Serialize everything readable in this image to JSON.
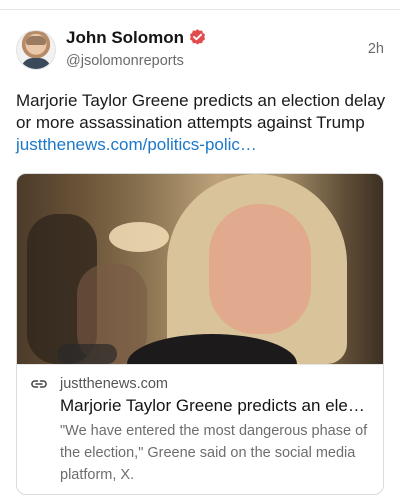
{
  "post": {
    "display_name": "John Solomon",
    "handle": "@jsolomonreports",
    "time": "2h",
    "verified_icon": "verified-badge-icon",
    "text": "Marjorie Taylor Greene predicts an election delay or more assassination attempts against Trump ",
    "link_text": "justthenews.com/politics-polic…"
  },
  "card": {
    "domain": "justthenews.com",
    "title": "Marjorie Taylor Greene predicts an ele…",
    "description": "\"We have entered the most dangerous phase of the election,\" Greene said on the social media platform, X.",
    "link_icon": "link-icon"
  },
  "colors": {
    "link": "#1b78c9",
    "verified": "#e24b4b",
    "secondary_text": "#6b6b6b"
  }
}
